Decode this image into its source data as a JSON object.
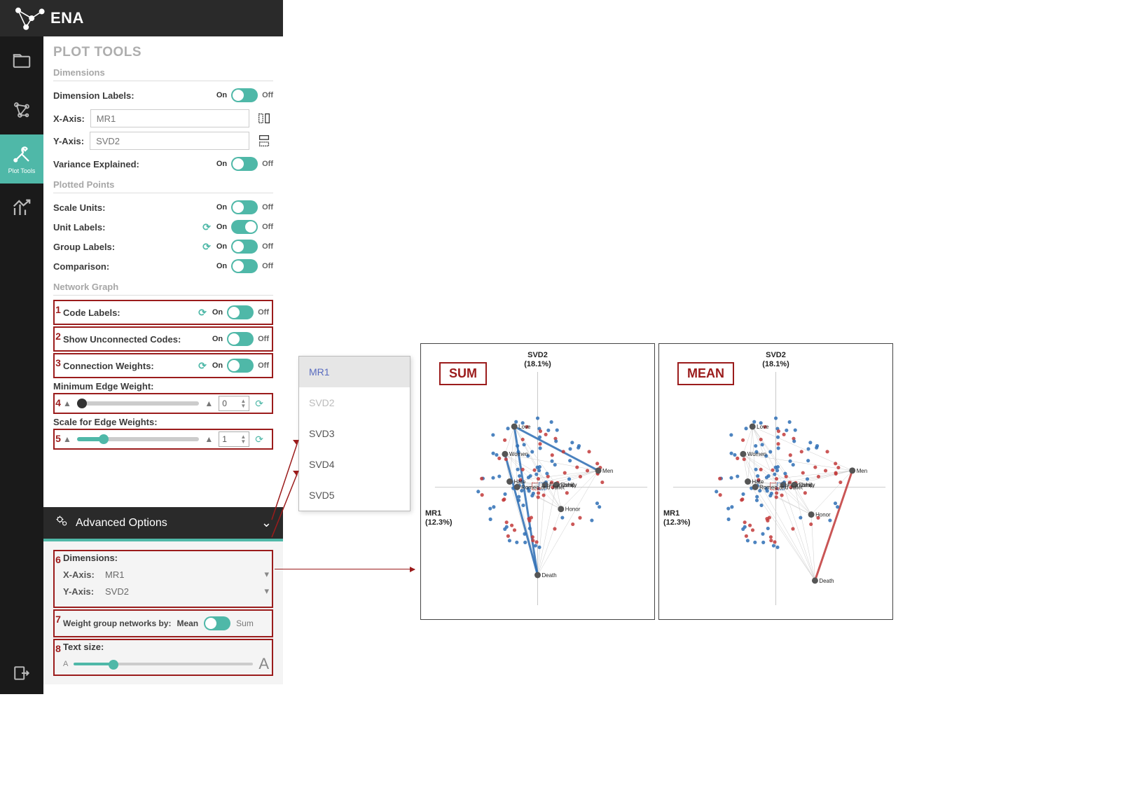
{
  "brand": "ENA",
  "nav": {
    "active_label": "Plot Tools"
  },
  "panel_title": "PLOT TOOLS",
  "sections": {
    "dimensions": "Dimensions",
    "plotted_points": "Plotted Points",
    "network_graph": "Network Graph"
  },
  "dimension_labels": {
    "label": "Dimension Labels:",
    "state": "on",
    "on": "On",
    "off": "Off"
  },
  "xaxis": {
    "label": "X-Axis:",
    "value": "MR1"
  },
  "yaxis": {
    "label": "Y-Axis:",
    "value": "SVD2"
  },
  "variance": {
    "label": "Variance Explained:",
    "state": "on",
    "on": "On",
    "off": "Off"
  },
  "scale_units": {
    "label": "Scale Units:",
    "state": "on",
    "on": "On",
    "off": "Off"
  },
  "unit_labels": {
    "label": "Unit Labels:",
    "state": "off",
    "on": "On",
    "off": "Off",
    "has_refresh": true
  },
  "group_labels": {
    "label": "Group Labels:",
    "state": "on",
    "on": "On",
    "off": "Off",
    "has_refresh": true
  },
  "comparison": {
    "label": "Comparison:",
    "state": "on",
    "on": "On",
    "off": "Off"
  },
  "code_labels": {
    "num": "1",
    "label": "Code Labels:",
    "state": "on",
    "on": "On",
    "off": "Off",
    "has_refresh": true
  },
  "show_unconnected": {
    "num": "2",
    "label": "Show Unconnected Codes:",
    "state": "on",
    "on": "On",
    "off": "Off"
  },
  "conn_weights": {
    "num": "3",
    "label": "Connection Weights:",
    "state": "on",
    "on": "On",
    "off": "Off",
    "has_refresh": true
  },
  "min_edge": {
    "num": "4",
    "label": "Minimum Edge Weight:",
    "slider_pct": 4,
    "value": "0"
  },
  "scale_edge": {
    "num": "5",
    "label": "Scale for Edge Weights:",
    "slider_pct": 22,
    "value": "1"
  },
  "advanced_header": "Advanced Options",
  "adv_dimensions_label": "Dimensions:",
  "adv_x": {
    "num": "6",
    "label": "X-Axis:",
    "value": "MR1"
  },
  "adv_y": {
    "label": "Y-Axis:",
    "value": "SVD2"
  },
  "weight_by": {
    "num": "7",
    "label": "Weight group networks by:",
    "left": "Mean",
    "right": "Sum",
    "state": "mean"
  },
  "text_size": {
    "num": "8",
    "label": "Text size:",
    "slider_pct": 22
  },
  "dropdown": {
    "items": [
      {
        "label": "MR1",
        "state": "selected"
      },
      {
        "label": "SVD2",
        "state": "disabled"
      },
      {
        "label": "SVD3",
        "state": "normal"
      },
      {
        "label": "SVD4",
        "state": "normal"
      },
      {
        "label": "SVD5",
        "state": "normal"
      }
    ]
  },
  "plots": {
    "sum_badge": "SUM",
    "mean_badge": "MEAN",
    "y_title": "SVD2",
    "y_sub": "(18.1%)",
    "x_title": "MR1",
    "x_sub": "(12.3%)",
    "node_labels": [
      "Love",
      "Women",
      "Men",
      "Hate",
      "Death",
      "Honor",
      "Friendship",
      "Family",
      "Romeo and Juliet"
    ]
  },
  "chart_data": [
    {
      "type": "scatter",
      "label": "SUM",
      "xlabel": "MR1 (12.3%)",
      "ylabel": "SVD2 (18.1%)",
      "xlim": [
        -1,
        1
      ],
      "ylim": [
        -1,
        1
      ],
      "nodes": [
        {
          "name": "Love",
          "x": -0.25,
          "y": 0.55
        },
        {
          "name": "Women",
          "x": -0.35,
          "y": 0.3
        },
        {
          "name": "Men",
          "x": 0.65,
          "y": 0.15
        },
        {
          "name": "Hate",
          "x": -0.3,
          "y": 0.05
        },
        {
          "name": "Friendship",
          "x": 0.08,
          "y": 0.02
        },
        {
          "name": "Family",
          "x": 0.2,
          "y": 0.02
        },
        {
          "name": "Romeo and Juliet",
          "x": -0.22,
          "y": 0.0
        },
        {
          "name": "Honor",
          "x": 0.25,
          "y": -0.2
        },
        {
          "name": "Death",
          "x": 0.0,
          "y": -0.8
        }
      ],
      "edges_heavy": [
        [
          "Love",
          "Death"
        ],
        [
          "Women",
          "Death"
        ],
        [
          "Love",
          "Men"
        ]
      ],
      "points_approx": 120,
      "groups": [
        "blue",
        "red"
      ]
    },
    {
      "type": "scatter",
      "label": "MEAN",
      "xlabel": "MR1 (12.3%)",
      "ylabel": "SVD2 (18.1%)",
      "xlim": [
        -1,
        1
      ],
      "ylim": [
        -1,
        1
      ],
      "nodes": [
        {
          "name": "Love",
          "x": -0.25,
          "y": 0.55
        },
        {
          "name": "Women",
          "x": -0.35,
          "y": 0.3
        },
        {
          "name": "Men",
          "x": 0.82,
          "y": 0.15
        },
        {
          "name": "Hate",
          "x": -0.3,
          "y": 0.05
        },
        {
          "name": "Friendship",
          "x": 0.08,
          "y": 0.02
        },
        {
          "name": "Family",
          "x": 0.2,
          "y": 0.02
        },
        {
          "name": "Romeo and Juliet",
          "x": -0.22,
          "y": 0.0
        },
        {
          "name": "Honor",
          "x": 0.38,
          "y": -0.25
        },
        {
          "name": "Death",
          "x": 0.42,
          "y": -0.85
        }
      ],
      "edges_heavy": [
        [
          "Men",
          "Death"
        ]
      ],
      "points_approx": 120,
      "groups": [
        "blue",
        "red"
      ]
    }
  ]
}
